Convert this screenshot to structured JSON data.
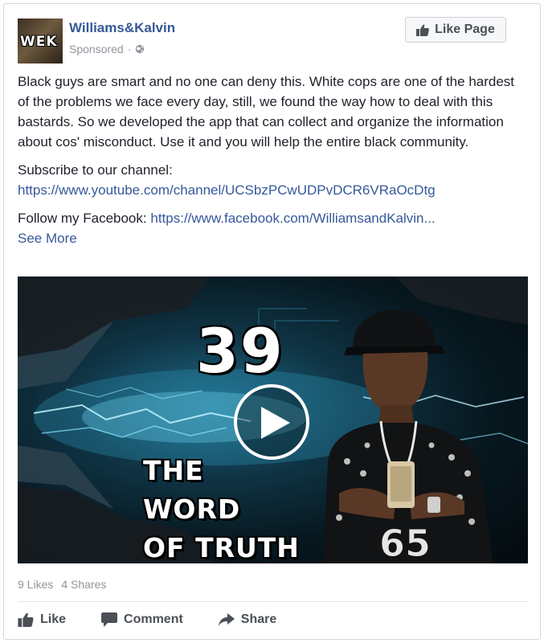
{
  "page": {
    "name": "Williams&Kalvin",
    "avatar_text": "WEK",
    "sponsored_label": "Sponsored",
    "separator": "·",
    "like_page_label": "Like Page"
  },
  "post": {
    "paragraph1": "Black guys are smart and no one can deny this. White cops are one of the hardest of the problems we face every day, still, we found the way how to deal with this bastards. So we developed the app that can collect and organize the information about cos' misconduct. Use it and you will help the entire black community.",
    "subscribe_label": "Subscribe to our channel:",
    "subscribe_link": "https://www.youtube.com/channel/UCSbzPCwUDPvDCR6VRaOcDtg",
    "follow_label": "Follow my Facebook:",
    "follow_link": "https://www.facebook.com/WilliamsandKalvin...",
    "see_more_label": "See More"
  },
  "video": {
    "number": "39",
    "title_line1": "THE WORD",
    "title_line2": "OF TRUTH",
    "shirt_number": "65"
  },
  "stats": {
    "likes": "9 Likes",
    "shares": "4 Shares"
  },
  "actions": {
    "like_label": "Like",
    "comment_label": "Comment",
    "share_label": "Share"
  },
  "colors": {
    "link": "#365899",
    "muted": "#90949c",
    "text": "#1d2129"
  },
  "icons": {
    "like_page": "thumbs-up-icon",
    "globe": "globe-icon",
    "play": "play-icon",
    "like": "thumbs-up-icon",
    "comment": "comment-icon",
    "share": "share-arrow-icon"
  }
}
